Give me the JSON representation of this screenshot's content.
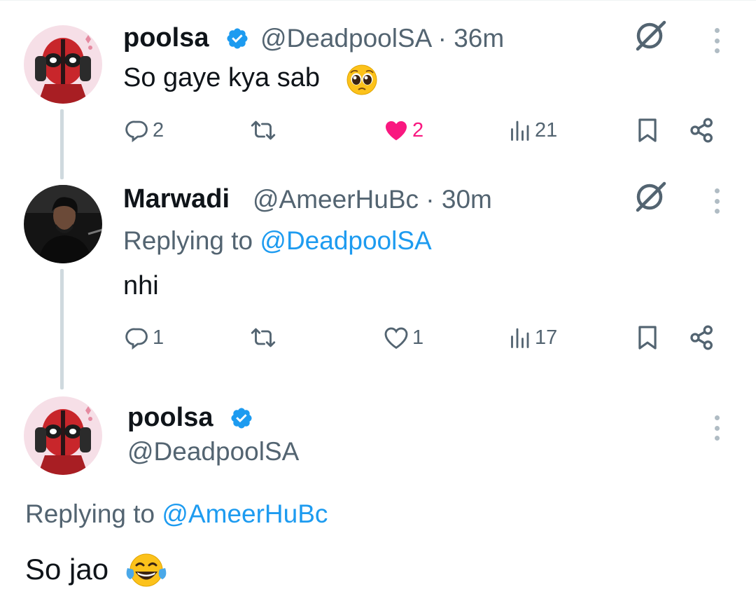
{
  "tweets": [
    {
      "display_name": "poolsa",
      "handle": "@DeadpoolSA",
      "time": "36m",
      "verified": true,
      "text": "So gaye kya sab",
      "emoji": "pleading-face",
      "stats": {
        "replies": "2",
        "reposts": "",
        "likes": "2",
        "views": "21"
      },
      "liked": true
    },
    {
      "display_name": "Marwadi",
      "handle": "@AmeerHuBc",
      "time": "30m",
      "verified": false,
      "replying_label": "Replying to",
      "replying_to": "@DeadpoolSA",
      "text": "nhi",
      "stats": {
        "replies": "1",
        "reposts": "",
        "likes": "1",
        "views": "17"
      },
      "liked": false
    },
    {
      "display_name": "poolsa",
      "handle": "@DeadpoolSA",
      "verified": true,
      "replying_label": "Replying to",
      "replying_to": "@AmeerHuBc",
      "text": "So jao",
      "emoji": "tears-of-joy"
    }
  ],
  "colors": {
    "text": "#0f1419",
    "secondary": "#536471",
    "link": "#1d9bf0",
    "like": "#f91880",
    "verified": "#1d9bf0",
    "thread_line": "#cfd9de"
  }
}
